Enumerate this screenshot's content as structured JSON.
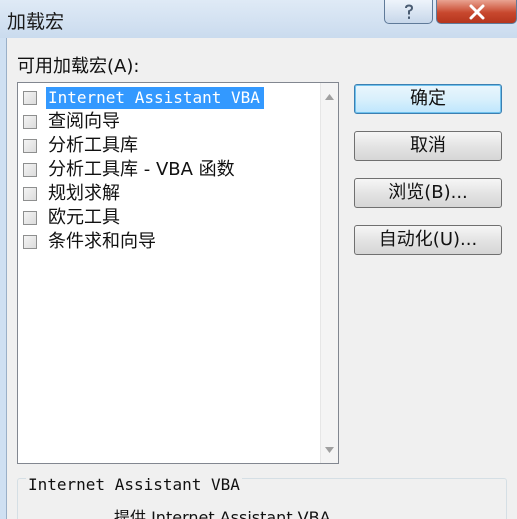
{
  "window": {
    "title": "加载宏"
  },
  "addins_list": {
    "label": "可用加载宏(A):",
    "items": [
      {
        "label": "Internet Assistant VBA",
        "checked": false,
        "selected": true
      },
      {
        "label": "查阅向导",
        "checked": false,
        "selected": false
      },
      {
        "label": "分析工具库",
        "checked": false,
        "selected": false
      },
      {
        "label": "分析工具库 - VBA 函数",
        "checked": false,
        "selected": false
      },
      {
        "label": "规划求解",
        "checked": false,
        "selected": false
      },
      {
        "label": "欧元工具",
        "checked": false,
        "selected": false
      },
      {
        "label": "条件求和向导",
        "checked": false,
        "selected": false
      }
    ]
  },
  "buttons": {
    "ok": "确定",
    "cancel": "取消",
    "browse": "浏览(B)...",
    "automation": "自动化(U)..."
  },
  "description": {
    "group_label": "Internet Assistant VBA",
    "text": "提供 Internet Assistant VBA"
  }
}
